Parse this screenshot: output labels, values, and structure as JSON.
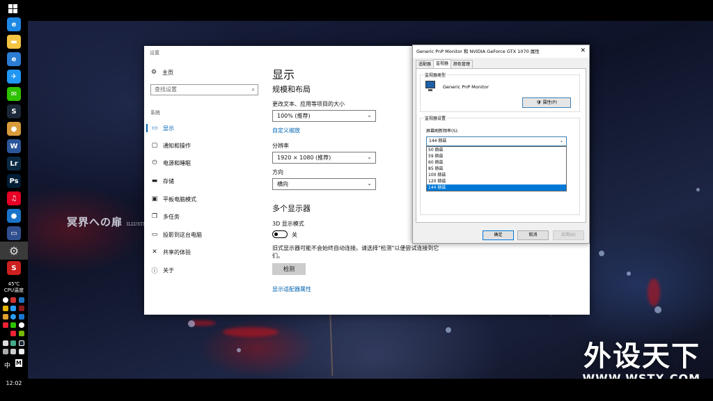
{
  "wallpaper": {
    "text": "冥界への扉",
    "sub": "ILLUSTRATION"
  },
  "watermark": {
    "main": "外设天下",
    "url": "WWW.WSTX.COM"
  },
  "taskbar": {
    "apps": [
      {
        "name": "browser-icon",
        "color": "#1e88e5",
        "glyph": "e"
      },
      {
        "name": "file-explorer-icon",
        "color": "#f4c542",
        "glyph": "▬"
      },
      {
        "name": "edge-browser-icon",
        "color": "#2b7cd3",
        "glyph": "e"
      },
      {
        "name": "bird-app-icon",
        "color": "#2196f3",
        "glyph": "✈"
      },
      {
        "name": "wechat-icon",
        "color": "#2dc100",
        "glyph": "✉"
      },
      {
        "name": "steam-icon",
        "color": "#1b2838",
        "glyph": "S"
      },
      {
        "name": "app-orange-icon",
        "color": "#d89a3a",
        "glyph": "●"
      },
      {
        "name": "word-icon",
        "color": "#2b579a",
        "glyph": "W"
      },
      {
        "name": "lightroom-icon",
        "color": "#0a2a43",
        "glyph": "Lr"
      },
      {
        "name": "photoshop-icon",
        "color": "#001e36",
        "glyph": "Ps"
      },
      {
        "name": "netease-music-icon",
        "color": "#e60026",
        "glyph": "♫"
      },
      {
        "name": "app-blue-icon",
        "color": "#1a73c8",
        "glyph": "●"
      },
      {
        "name": "app-monitor-icon",
        "color": "#2f4f8f",
        "glyph": "▭"
      },
      {
        "name": "settings-gear-icon",
        "color": "#3a3a3a",
        "glyph": "⚙",
        "active": true
      },
      {
        "name": "app-s-icon",
        "color": "#cc1f1f",
        "glyph": "S"
      }
    ],
    "cpu_temp": "45℃",
    "cpu_label": "CPU温度",
    "ime": "中",
    "ime_mode": "M",
    "clock": "12:02"
  },
  "settings": {
    "window_title": "设置",
    "home": "主页",
    "search_placeholder": "查找设置",
    "group": "系统",
    "nav": [
      {
        "label": "显示",
        "icon": "display-icon",
        "glyph": "▭",
        "selected": true
      },
      {
        "label": "通知和操作",
        "icon": "notification-icon",
        "glyph": "▢"
      },
      {
        "label": "电源和睡眠",
        "icon": "power-icon",
        "glyph": "⏻"
      },
      {
        "label": "存储",
        "icon": "storage-icon",
        "glyph": "▬"
      },
      {
        "label": "平板电脑模式",
        "icon": "tablet-icon",
        "glyph": "▣"
      },
      {
        "label": "多任务",
        "icon": "multitask-icon",
        "glyph": "❐"
      },
      {
        "label": "投影到这台电脑",
        "icon": "project-icon",
        "glyph": "▭"
      },
      {
        "label": "共享的体验",
        "icon": "share-icon",
        "glyph": "✕"
      },
      {
        "label": "关于",
        "icon": "about-icon",
        "glyph": "ⓘ"
      }
    ],
    "content": {
      "title": "显示",
      "scale_layout_heading": "规模和布局",
      "scale_label": "更改文本、应用等项目的大小",
      "scale_value": "100% (推荐)",
      "custom_scale_link": "自定义缩放",
      "resolution_label": "分辨率",
      "resolution_value": "1920 × 1080 (推荐)",
      "orientation_label": "方向",
      "orientation_value": "横向",
      "multi_display_heading": "多个显示器",
      "mode_3d_label": "3D 显示模式",
      "toggle_state": "关",
      "legacy_text": "旧式显示器可能不会始终自动连接。请选择\"检测\"以便尝试连接到它们。",
      "detect_button": "检测",
      "adapter_link": "显示适配器属性"
    }
  },
  "props": {
    "title": "Generic PnP Monitor 和 NVIDIA GeForce GTX 1070 属性",
    "tabs": [
      "适配器",
      "监视器",
      "颜色管理"
    ],
    "active_tab": 1,
    "monitor_type_group": "监视器类型",
    "monitor_name": "Generic PnP Monitor",
    "properties_button": "属性(P)",
    "monitor_settings_group": "监视器设置",
    "refresh_label": "屏幕刷新频率(S):",
    "refresh_value": "144 赫兹",
    "refresh_options": [
      "50 赫兹",
      "59 赫兹",
      "60 赫兹",
      "85 赫兹",
      "100 赫兹",
      "120 赫兹",
      "144 赫兹"
    ],
    "refresh_selected_index": 6,
    "ok_button": "确定",
    "cancel_button": "取消",
    "apply_button": "应用(A)"
  }
}
